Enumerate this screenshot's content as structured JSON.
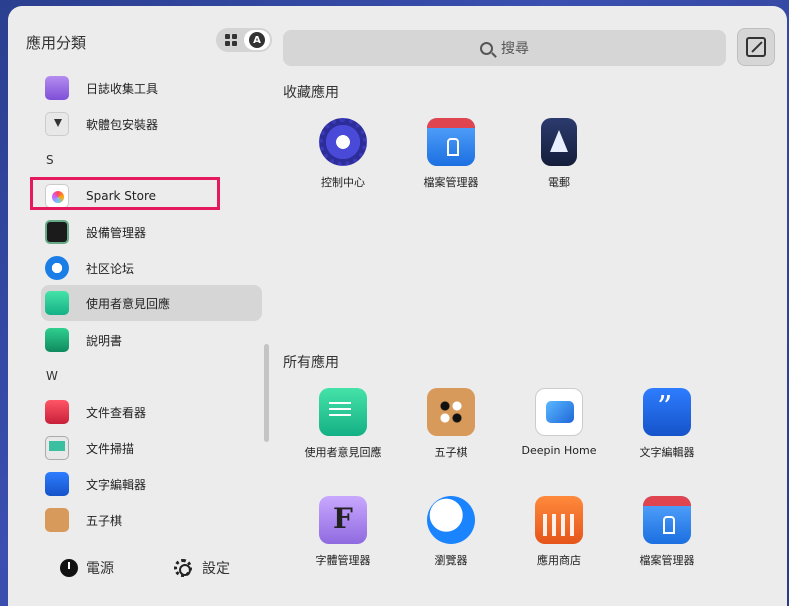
{
  "sidebar": {
    "title": "應用分類",
    "items": [
      {
        "label": "日誌收集工具",
        "icon": "log-collector-icon"
      },
      {
        "label": "軟體包安裝器",
        "icon": "package-installer-icon"
      },
      {
        "label": "Spark Store",
        "icon": "spark-store-icon"
      },
      {
        "label": "設備管理器",
        "icon": "device-manager-icon"
      },
      {
        "label": "社区论坛",
        "icon": "community-forum-icon"
      },
      {
        "label": "使用者意見回應",
        "icon": "feedback-icon"
      },
      {
        "label": "說明書",
        "icon": "manual-icon"
      },
      {
        "label": "文件查看器",
        "icon": "document-viewer-icon"
      },
      {
        "label": "文件掃描",
        "icon": "document-scanner-icon"
      },
      {
        "label": "文字編輯器",
        "icon": "text-editor-icon"
      },
      {
        "label": "五子棋",
        "icon": "gomoku-icon"
      }
    ],
    "letters": [
      "S",
      "W"
    ],
    "power_label": "電源",
    "settings_label": "設定"
  },
  "search": {
    "placeholder": "搜尋"
  },
  "favorites": {
    "title": "收藏應用",
    "apps": [
      {
        "label": "控制中心",
        "icon": "control-center-icon"
      },
      {
        "label": "檔案管理器",
        "icon": "file-manager-icon"
      },
      {
        "label": "電郵",
        "icon": "mail-icon"
      }
    ]
  },
  "all_apps": {
    "title": "所有應用",
    "apps": [
      {
        "label": "使用者意見回應",
        "icon": "feedback-icon"
      },
      {
        "label": "五子棋",
        "icon": "gomoku-icon"
      },
      {
        "label": "Deepin Home",
        "icon": "deepin-home-icon"
      },
      {
        "label": "文字編輯器",
        "icon": "text-editor-icon"
      },
      {
        "label": "字體管理器",
        "icon": "font-manager-icon"
      },
      {
        "label": "瀏覽器",
        "icon": "browser-icon"
      },
      {
        "label": "應用商店",
        "icon": "app-store-icon"
      },
      {
        "label": "檔案管理器",
        "icon": "file-manager-icon"
      }
    ]
  },
  "colors": {
    "highlight_box": "#e5195d",
    "panel_bg": "#ececec"
  }
}
